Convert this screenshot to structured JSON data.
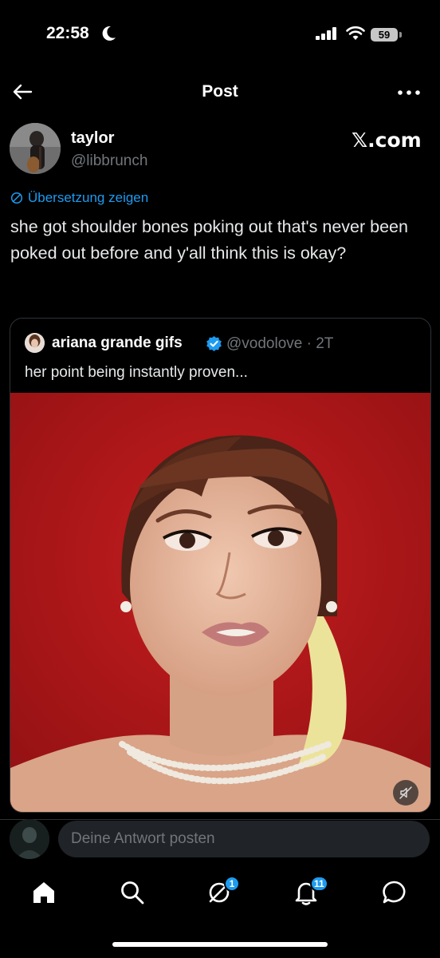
{
  "status_bar": {
    "time": "22:58",
    "battery": "59"
  },
  "header": {
    "title": "Post"
  },
  "post": {
    "author_name": "taylor",
    "author_handle": "@libbrunch",
    "watermark": "𝕏.com",
    "translate_label": "Übersetzung zeigen",
    "text": "she got shoulder bones poking out that's never been poked out before and y'all think this is okay?"
  },
  "quote": {
    "name": "ariana grande gifs",
    "handle": "@vodolove",
    "time": "· 2T",
    "text": "her point being instantly proven..."
  },
  "reply": {
    "placeholder": "Deine Antwort posten"
  },
  "nav": {
    "grok_badge": "1",
    "notifications_badge": "11"
  },
  "colors": {
    "accent": "#1d9bf0",
    "background": "#000000",
    "media_bg": "#b1181a"
  }
}
